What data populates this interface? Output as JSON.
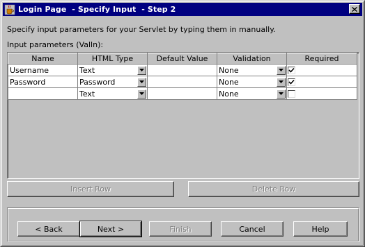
{
  "window": {
    "title": "Login Page  - Specify Input  - Step 2",
    "icon": "java-cup-icon"
  },
  "instruction": "Specify input parameters for your Servlet by typing them in manually.",
  "table_label": "Input parameters (Valln):",
  "table": {
    "columns": [
      "Name",
      "HTML Type",
      "Default Value",
      "Validation",
      "Required"
    ],
    "rows": [
      {
        "name": "Username",
        "html_type": "Text",
        "default_value": "",
        "validation": "None",
        "required": true
      },
      {
        "name": "Password",
        "html_type": "Password",
        "default_value": "",
        "validation": "None",
        "required": true
      },
      {
        "name": "",
        "html_type": "Text",
        "default_value": "",
        "validation": "None",
        "required": false
      }
    ]
  },
  "buttons": {
    "insert_row": "Insert Row",
    "delete_row": "Delete Row",
    "back": "< Back",
    "next": "Next >",
    "finish": "Finish",
    "cancel": "Cancel",
    "help": "Help"
  },
  "colors": {
    "titlebar": "#000080",
    "face": "#c0c0c0",
    "disabled_text": "#808080"
  }
}
